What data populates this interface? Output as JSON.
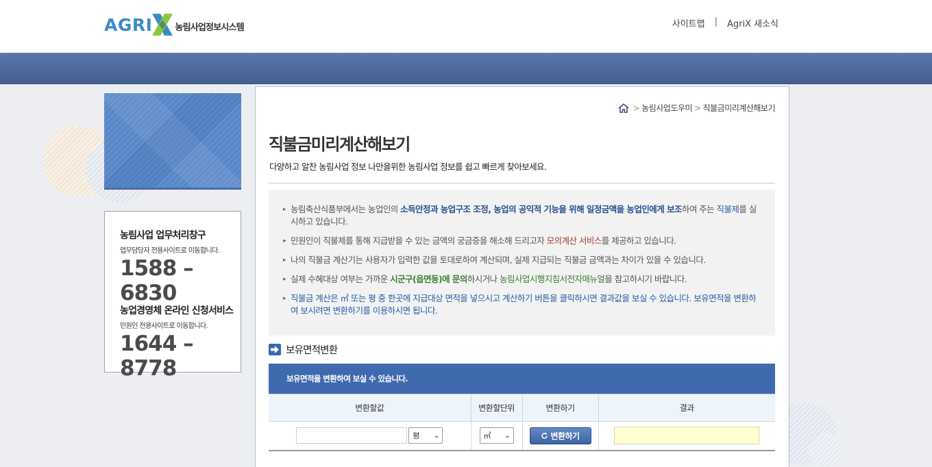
{
  "header": {
    "logo_text": "AGRI",
    "logo_subtitle": "농림사업정보시스템",
    "links": [
      "사이트맵",
      "AgriX 새소식"
    ],
    "link_separator": "|"
  },
  "sidebar": {
    "services": [
      {
        "title": "농림사업 업무처리창구",
        "subtitle": "업무담당자 전용사이트로 이동합니다.",
        "phone": "1588 – 6830"
      },
      {
        "title": "농업경영체 온라인 신청서비스",
        "subtitle": "민원인 전용사이트로 이동합니다.",
        "phone": "1644 – 8778"
      }
    ]
  },
  "breadcrumb": {
    "items": [
      "농림사업도우미",
      "직불금미리계산해보기"
    ],
    "separator": ">"
  },
  "page": {
    "title": "직불금미리계산해보기",
    "description": "다양하고 알찬 농림사업 정보 나만을위한 농림사업 정보를 쉽고 빠르게 찾아보세요."
  },
  "info": {
    "item1": {
      "p1": "농림축산식품부에서는 농업인의 ",
      "h1": "소득안정과 농업구조 조정, 농업의 공익적 기능을 위해 일정금액을 농업인에게 보조",
      "p2": "하여 주는 ",
      "h2": "직불제",
      "p3": "를 실시하고 있습니다."
    },
    "item2": {
      "p1": "민원인이 직불제를 통해 지급받을 수 있는 금액의 궁금증을 해소해 드리고자 ",
      "h1": "모의계산 서비스",
      "p2": "를 제공하고 있습니다."
    },
    "item3": "나의 직불금 계산기는 사용자가 입력한 값을 토대로하여 계산되며, 실제 지급되는 직불금 금액과는 차이가 있을 수 있습니다.",
    "item4": {
      "p1": "실제 수혜대상 여부는 가까운 ",
      "h1": "시군구(읍면동)에 문의",
      "p2": "하시거나 ",
      "h2": "농림사업시행지침서전자매뉴얼",
      "p3": "을 참고하시기 바랍니다."
    },
    "item5": {
      "p1": "직불금 계산은 ㎡ 또는 평 중 한곳에 지급대상 면적을 넣으시고 계산하기 버튼을 클릭하시면 결과값을 보실 수 있습니다. ",
      "h1": "보유면적을 변환하여 보시려면 변환하기를 이용하시면 됩니다."
    }
  },
  "converter": {
    "section_title": "보유면적변환",
    "band_text": "보유면적을 변환하여 보실 수 있습니다.",
    "headers": [
      "변환할값",
      "변환할단위",
      "변환하기",
      "결과"
    ],
    "value": "",
    "value_unit": "평",
    "target_unit": "㎡",
    "button_label": "변환하기",
    "result": ""
  },
  "colors": {
    "accent": "#3f6aae",
    "nav": "#4f6a9b",
    "result_bg": "#ffffd2"
  }
}
